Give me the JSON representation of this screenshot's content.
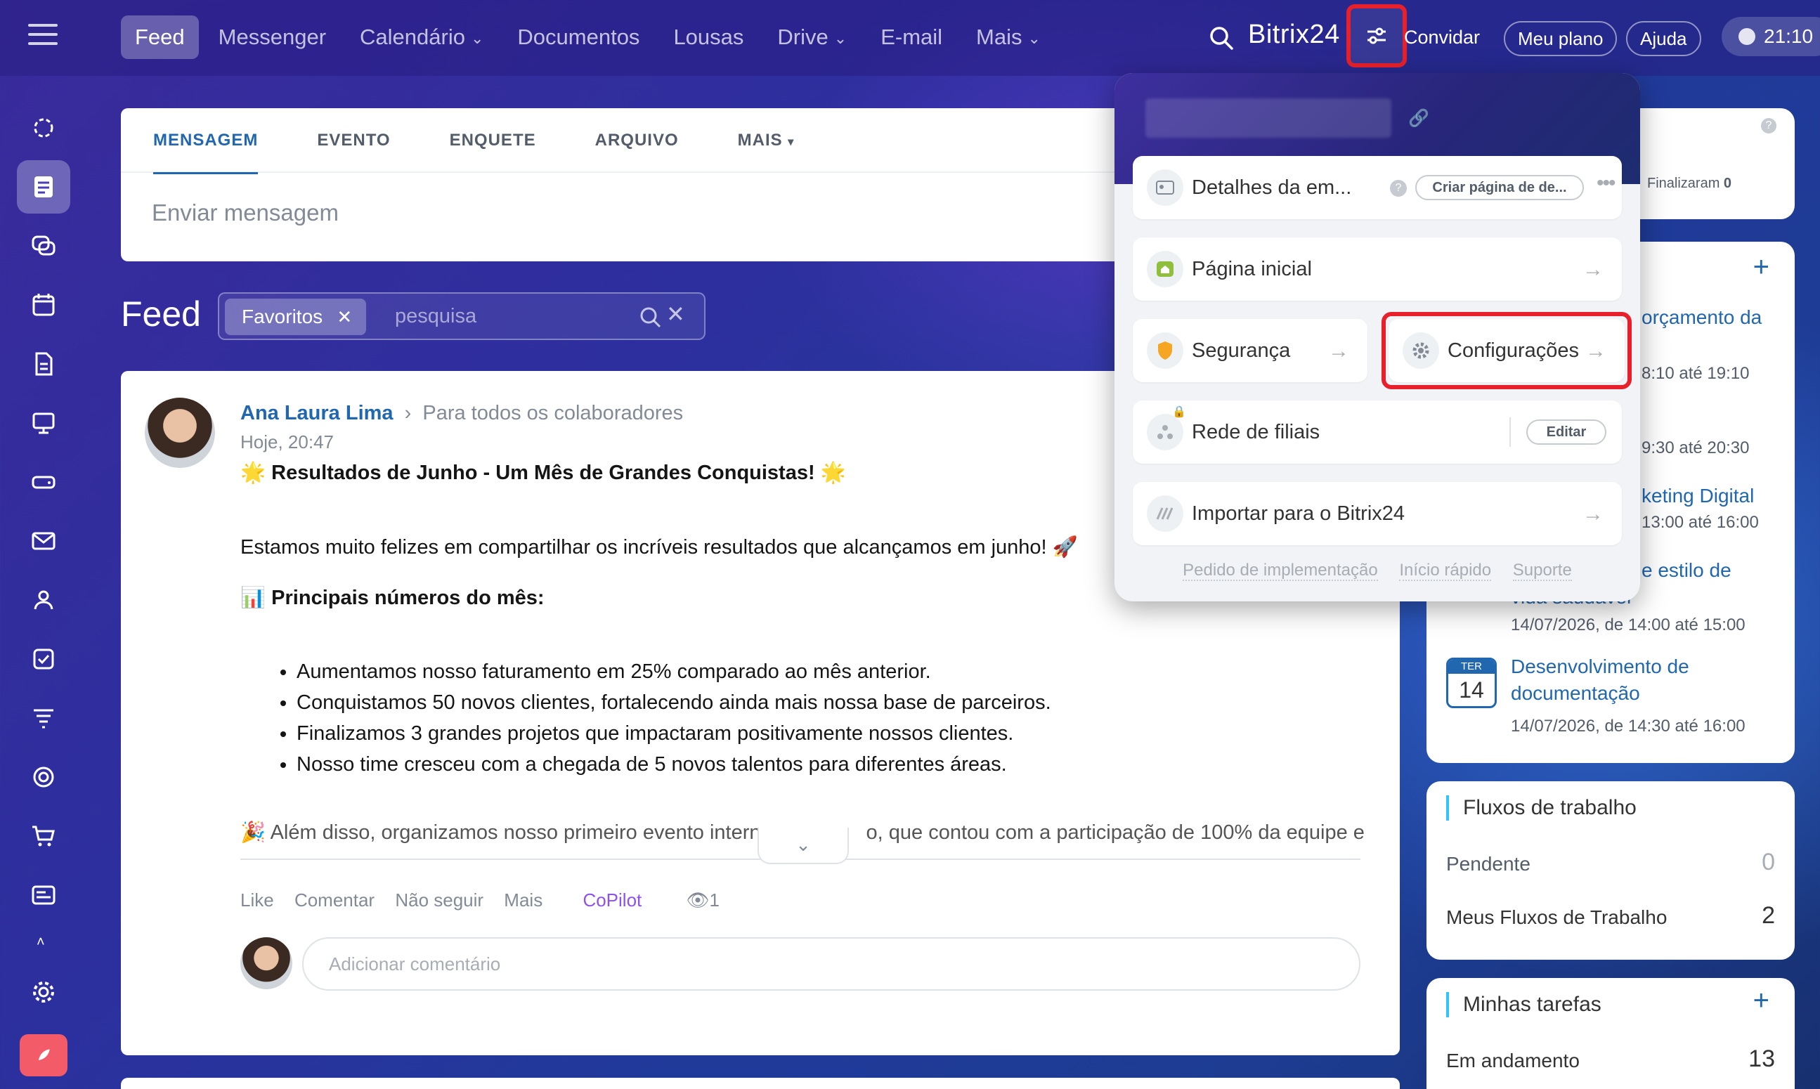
{
  "top_nav": {
    "items": [
      {
        "label": "Feed",
        "active": true
      },
      {
        "label": "Messenger"
      },
      {
        "label": "Calendário",
        "dropdown": true
      },
      {
        "label": "Documentos"
      },
      {
        "label": "Lousas"
      },
      {
        "label": "Drive",
        "dropdown": true
      },
      {
        "label": "E-mail"
      },
      {
        "label": "Mais",
        "dropdown": true
      }
    ],
    "brand": "Bitrix24",
    "invite": "Convidar",
    "plan": "Meu plano",
    "help": "Ajuda",
    "time": "21:10"
  },
  "composer": {
    "tabs": [
      "MENSAGEM",
      "EVENTO",
      "ENQUETE",
      "ARQUIVO",
      "MAIS"
    ],
    "placeholder": "Enviar mensagem"
  },
  "feed": {
    "title": "Feed",
    "filter_chip": "Favoritos",
    "search_placeholder": "pesquisa"
  },
  "post": {
    "author": "Ana Laura Lima",
    "audience": "Para todos os colaboradores",
    "time": "Hoje, 20:47",
    "title": "Resultados de Junho - Um Mês de Grandes Conquistas!",
    "intro": "Estamos muito felizes em compartilhar os incríveis resultados que alcançamos em junho! 🚀",
    "section": "Principais números do mês:",
    "bullets": [
      "Aumentamos nosso faturamento em 25% comparado ao mês anterior.",
      "Conquistamos 50 novos clientes, fortalecendo ainda mais nossa base de parceiros.",
      "Finalizamos 3 grandes projetos que impactaram positivamente nossos clientes.",
      "Nosso time cresceu com a chegada de 5 novos talentos para diferentes áreas."
    ],
    "more_left": "🎉 Além disso, organizamos nosso primeiro evento intern",
    "more_right": "o, que contou com a participação de 100% da equipe e",
    "actions": [
      "Like",
      "Comentar",
      "Não seguir",
      "Mais"
    ],
    "copilot": "CoPilot",
    "views": "1",
    "comment_placeholder": "Adicionar comentário"
  },
  "popup": {
    "company": "Detalhes da em...",
    "create_page": "Criar página de de...",
    "home": "Página inicial",
    "security": "Segurança",
    "settings": "Configurações",
    "branches": "Rede de filiais",
    "edit": "Editar",
    "import": "Importar para o Bitrix24",
    "links": [
      "Pedido de implementação",
      "Início rápido",
      "Suporte"
    ]
  },
  "right": {
    "finished_label": "Finalizaram",
    "finished_count": "0",
    "events": [
      {
        "title_part": "orçamento da",
        "time": "8:10 até 19:10"
      },
      {
        "time": "9:30 até 20:30"
      },
      {
        "title_part": "keting Digital",
        "time": "13:00 até 16:00"
      },
      {
        "title_part": "e estilo de",
        "title_line2": "vida saudável",
        "time": "14/07/2026, de 14:00 até 15:00"
      },
      {
        "month": "TER",
        "day": "14",
        "title": "Desenvolvimento de",
        "title_line2": "documentação",
        "time": "14/07/2026, de 14:30 até 16:00"
      }
    ],
    "workflows": {
      "title": "Fluxos de trabalho",
      "rows": [
        {
          "label": "Pendente",
          "count": "0"
        },
        {
          "label": "Meus Fluxos de Trabalho",
          "count": "2"
        }
      ]
    },
    "tasks": {
      "title": "Minhas tarefas",
      "row_label": "Em andamento",
      "row_count": "13"
    }
  },
  "colors": {
    "accent": "#2067b0",
    "highlight": "#e8202b",
    "copilot": "#8e52ec"
  }
}
